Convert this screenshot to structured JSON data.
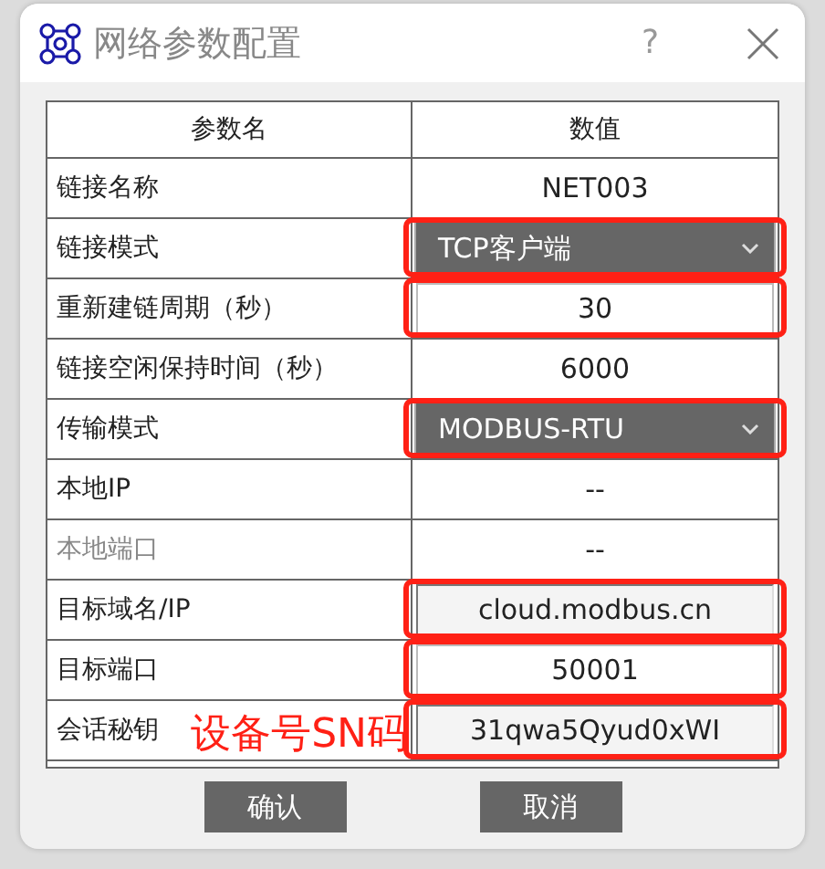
{
  "window": {
    "title": "网络参数配置",
    "help": "?"
  },
  "table": {
    "columns": [
      "参数名",
      "数值"
    ],
    "rows": [
      {
        "name": "链接名称",
        "value": "NET003",
        "kind": "text",
        "disabled": false,
        "highlighted": false
      },
      {
        "name": "链接模式",
        "value": "TCP客户端",
        "kind": "select",
        "disabled": false,
        "highlighted": true
      },
      {
        "name": "重新建链周期（秒）",
        "value": "30",
        "kind": "input",
        "disabled": false,
        "highlighted": true
      },
      {
        "name": "链接空闲保持时间（秒）",
        "value": "6000",
        "kind": "text",
        "disabled": false,
        "highlighted": false
      },
      {
        "name": "传输模式",
        "value": "MODBUS-RTU",
        "kind": "select",
        "disabled": false,
        "highlighted": true
      },
      {
        "name": "本地IP",
        "value": "--",
        "kind": "text",
        "disabled": false,
        "highlighted": false
      },
      {
        "name": "本地端口",
        "value": "--",
        "kind": "text",
        "disabled": true,
        "highlighted": false
      },
      {
        "name": "目标域名/IP",
        "value": "cloud.modbus.cn",
        "kind": "inset",
        "disabled": false,
        "highlighted": true
      },
      {
        "name": "目标端口",
        "value": "50001",
        "kind": "input",
        "disabled": false,
        "highlighted": true
      },
      {
        "name": "会话秘钥",
        "value": "31qwa5Qyud0xWI",
        "kind": "inset",
        "disabled": false,
        "highlighted": true,
        "annotation": "设备号SN码"
      }
    ]
  },
  "buttons": [
    "确认",
    "取消"
  ]
}
